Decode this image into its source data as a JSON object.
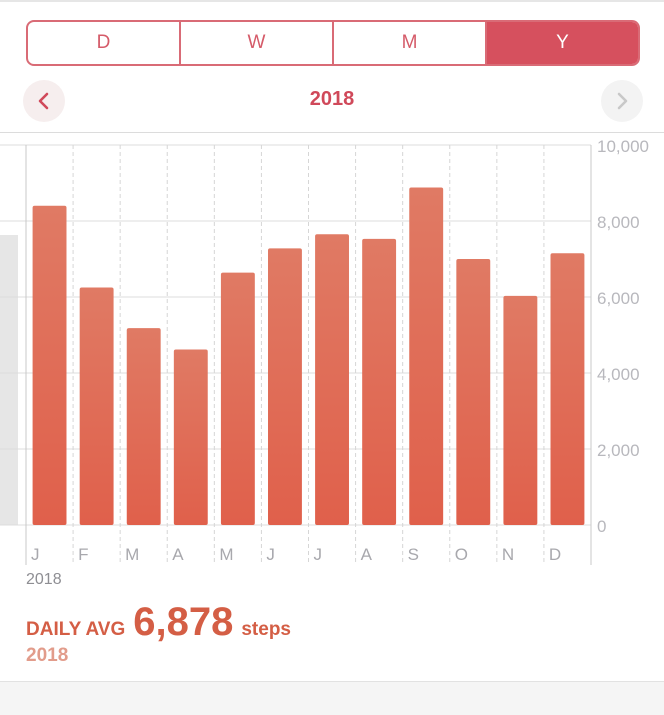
{
  "segments": [
    "D",
    "W",
    "M",
    "Y"
  ],
  "selected_segment": "Y",
  "period": {
    "title": "2018"
  },
  "nav": {
    "prev_icon": "chevron-left-icon",
    "next_icon": "chevron-right-icon"
  },
  "colors": {
    "accent": "#d6505e",
    "bar_top": "#e07a64",
    "bar_bottom": "#e0604b",
    "avg_text": "#d45e45",
    "avg_subtext": "#e29c8b"
  },
  "chart_data": {
    "type": "bar",
    "categories": [
      "J",
      "F",
      "M",
      "A",
      "M",
      "J",
      "J",
      "A",
      "S",
      "O",
      "N",
      "D"
    ],
    "values": [
      8400,
      6250,
      5180,
      4620,
      6640,
      7280,
      7650,
      7530,
      8880,
      7000,
      6030,
      7150
    ],
    "ylim": [
      0,
      10000
    ],
    "y_ticks": [
      "0",
      "2,000",
      "4,000",
      "6,000",
      "8,000",
      "10,000"
    ],
    "y_tick_values": [
      0,
      2000,
      4000,
      6000,
      8000,
      10000
    ],
    "x_caption": "2018",
    "grid": true,
    "y_axis_side": "right"
  },
  "summary": {
    "label": "DAILY AVG",
    "value": "6,878",
    "unit": "steps",
    "period": "2018"
  }
}
